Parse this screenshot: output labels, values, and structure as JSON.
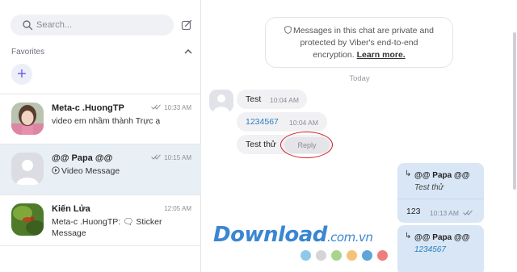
{
  "sidebar": {
    "search_placeholder": "Search...",
    "favorites_label": "Favorites",
    "add_favorite": "+",
    "chats": [
      {
        "name": "Meta-c .HuongTP",
        "time": "10:33 AM",
        "preview": "video em nhầm thành Trực ạ",
        "read": true
      },
      {
        "name": "@@ Papa @@",
        "time": "10:15 AM",
        "preview": "Video Message",
        "read": true
      },
      {
        "name": "Kiến Lửa",
        "time": "12:05 AM",
        "preview": "Meta-c .HuongTP: 🗨 Sticker Message",
        "read": false
      }
    ]
  },
  "chat": {
    "notice_line1": "Messages in this chat are private and",
    "notice_line2": "protected by Viber's end-to-end",
    "notice_line3": "encryption.",
    "notice_link": "Learn more.",
    "date_label": "Today",
    "incoming": [
      {
        "text": "Test",
        "time": "10:04 AM"
      },
      {
        "text": "1234567",
        "time": "10:04 AM"
      },
      {
        "text": "Test thử",
        "reply_label": "Reply"
      }
    ],
    "outgoing": [
      {
        "quote_name": "@@ Papa @@",
        "quote_text": "Test thử",
        "text": "123",
        "time": "10:13 AM"
      },
      {
        "quote_name": "@@ Papa @@",
        "quote_text": "1234567"
      }
    ]
  },
  "watermark": {
    "main": "Download",
    "domain": ".com.vn"
  },
  "colors": {
    "accent": "#7360f2",
    "active_row": "#e9f0f5",
    "outgoing_bubble": "#d8e6f5",
    "link": "#2a7ec0",
    "highlight_circle": "#d0232b",
    "watermark": "#3b86d1",
    "dots": [
      "#8fc9ea",
      "#d5d5d5",
      "#a8d48c",
      "#f5c27a",
      "#5ea6d9",
      "#ee7d7d"
    ]
  }
}
